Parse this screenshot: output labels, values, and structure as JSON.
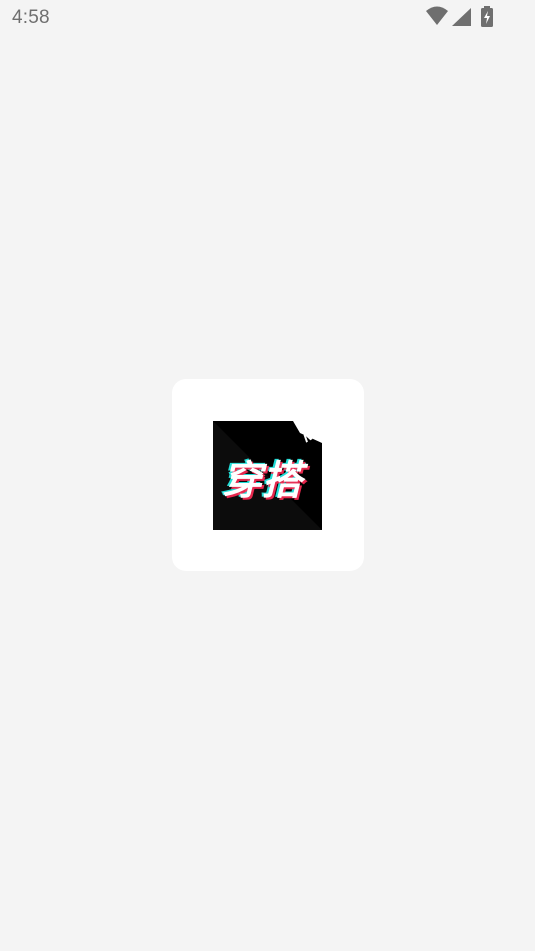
{
  "status_bar": {
    "time": "4:58",
    "icons": [
      "wifi-icon",
      "cellular-signal-icon",
      "battery-charging-icon"
    ]
  },
  "splash": {
    "logo_text": "穿搭",
    "logo_badge": "N",
    "colors": {
      "background": "#f4f4f4",
      "card": "#ffffff",
      "logo_bg": "#000000",
      "logo_shadow": "#222222",
      "glitch_cyan": "#25f4ee",
      "glitch_pink": "#fe2c55"
    }
  }
}
